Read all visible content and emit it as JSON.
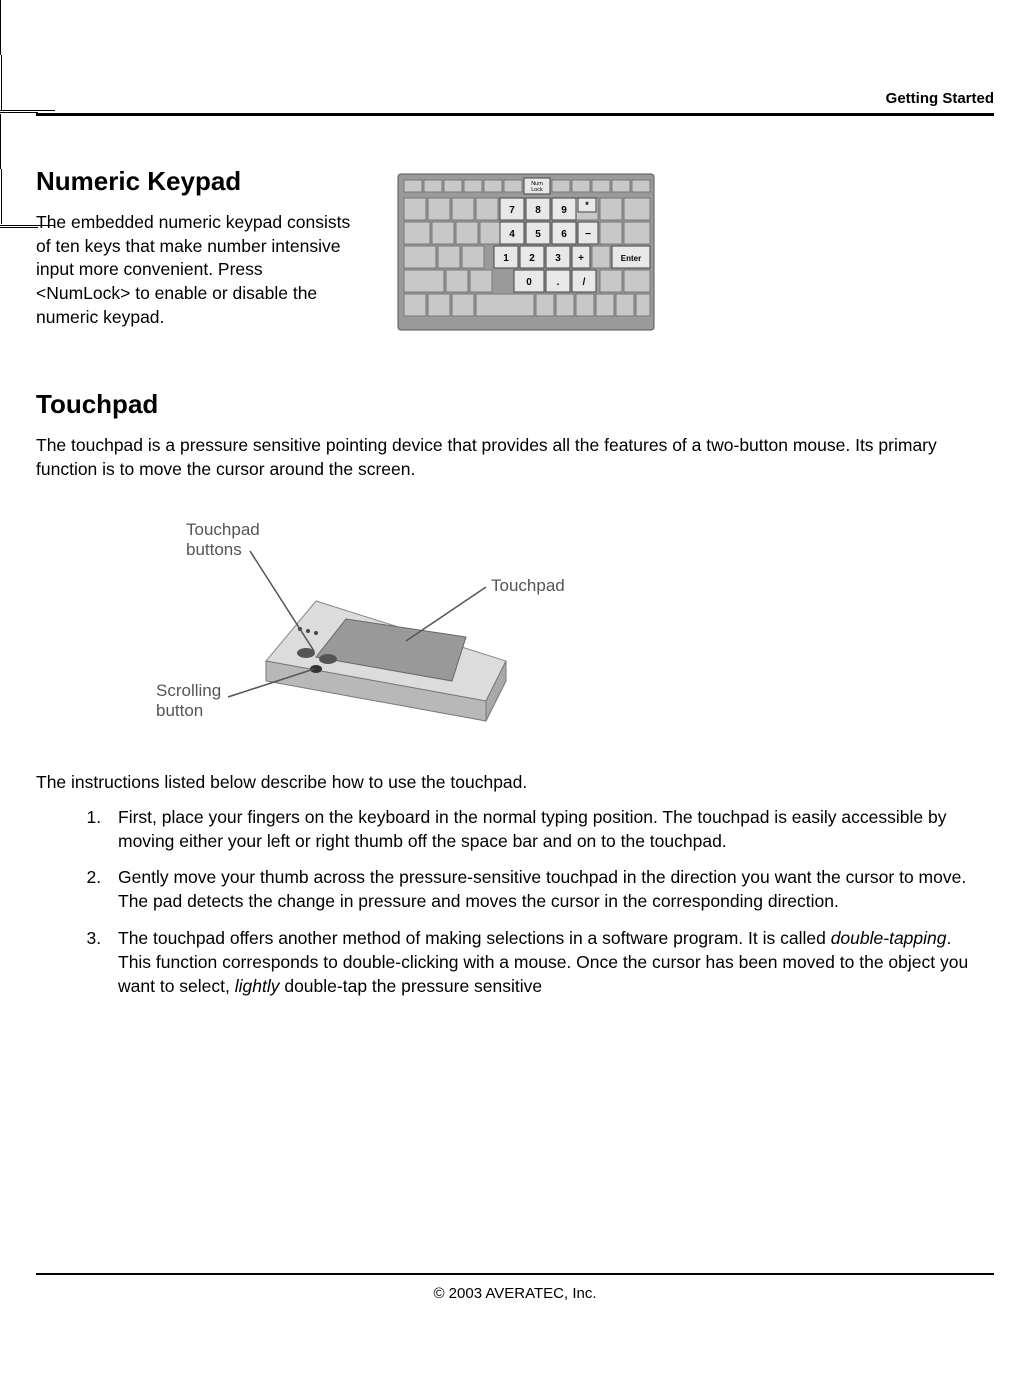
{
  "header": {
    "breadcrumb": "Getting Started"
  },
  "numeric_keypad": {
    "heading": "Numeric Keypad",
    "body": "The embedded numeric keypad consists of ten keys that make number intensive input more convenient. Press <NumLock> to enable or disable the numeric keypad."
  },
  "keypad_labels": {
    "numlock": "Num\nLock",
    "keys": [
      "7",
      "8",
      "9",
      "*",
      "4",
      "5",
      "6",
      "−",
      "1",
      "2",
      "3",
      "+",
      "0",
      ".",
      "/"
    ],
    "enter": "Enter"
  },
  "touchpad": {
    "heading": "Touchpad",
    "intro": "The touchpad is a pressure sensitive pointing device that provides all the features of a two-button mouse. Its primary function is to move the cursor around the screen.",
    "labels": {
      "buttons": "Touchpad\nbuttons",
      "touchpad": "Touchpad",
      "scrolling": "Scrolling\nbutton"
    },
    "instructions_lead": "The instructions listed below describe how to use the touchpad.",
    "steps": [
      "First, place your fingers on the keyboard in the normal typing position. The touchpad is easily accessible by moving either your left or right thumb off the space bar and on to the touchpad.",
      "Gently move your thumb across the pressure-sensitive touchpad in the direction you want the cursor to move. The pad detects the change in pressure and moves the cursor in the corresponding direction.",
      "The touchpad offers another method of making selections in a software program. It is called <i>double-tapping</i>. This function corresponds to double-clicking with a mouse. Once the cursor has been moved to the object you want to select, <i>lightly</i> double-tap the pressure sensitive"
    ]
  },
  "footer": {
    "copyright": "© 2003 AVERATEC, Inc."
  }
}
